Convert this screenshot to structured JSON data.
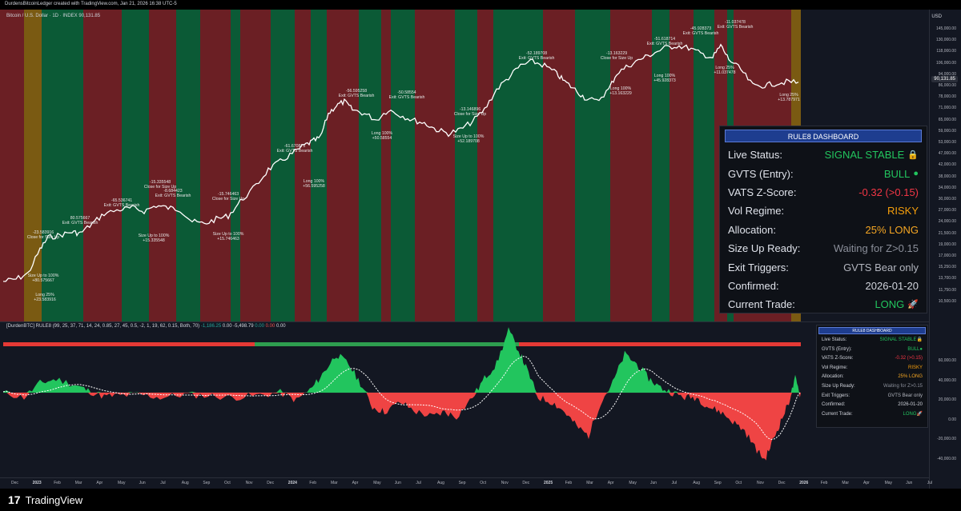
{
  "header": {
    "credit": "DurdensBitcoinLedger created with TradingView.com, Jan 21, 2026 16:38 UTC-5",
    "symbol": "Bitcoin / U.S. Dollar · 1D · INDEX",
    "last_price": "90,131.85",
    "currency": "USD",
    "current_price_label": "90,131.85"
  },
  "price_axis": [
    "145,000.00",
    "130,000.00",
    "118,000.00",
    "106,000.00",
    "94,000.00",
    "86,000.00",
    "78,000.00",
    "71,000.00",
    "65,000.00",
    "59,000.00",
    "53,000.00",
    "47,000.00",
    "42,000.00",
    "38,000.00",
    "34,000.00",
    "30,000.00",
    "27,000.00",
    "24,000.00",
    "21,500.00",
    "19,000.00",
    "17,000.00",
    "15,250.00",
    "13,700.00",
    "11,750.00",
    "10,500.00"
  ],
  "indicator_axis": [
    "60,000.00",
    "40,000.00",
    "20,000.00",
    "0.00",
    "-20,000.00",
    "-40,000.00"
  ],
  "time_axis": [
    "Dec",
    "2023",
    "Feb",
    "Mar",
    "Apr",
    "May",
    "Jun",
    "Jul",
    "Aug",
    "Sep",
    "Oct",
    "Nov",
    "Dec",
    "2024",
    "Feb",
    "Mar",
    "Apr",
    "May",
    "Jun",
    "Jul",
    "Aug",
    "Sep",
    "Oct",
    "Nov",
    "Dec",
    "2025",
    "Feb",
    "Mar",
    "Apr",
    "May",
    "Jun",
    "Jul",
    "Aug",
    "Sep",
    "Oct",
    "Nov",
    "Dec",
    "2026",
    "Feb",
    "Mar",
    "Apr",
    "May",
    "Jun",
    "Jul"
  ],
  "annotations": [
    {
      "text": "-23.583916"
    },
    {
      "text": "Close for Size Up"
    },
    {
      "text": "Size Up to 100%"
    },
    {
      "text": "+80.575667"
    },
    {
      "text": "Long 25%"
    },
    {
      "text": "+23.583916"
    },
    {
      "text": "80.575667"
    },
    {
      "text": "Exit: GVTS Bearish"
    },
    {
      "text": "-65.536741"
    },
    {
      "text": "Exit: GVTS Bearish"
    },
    {
      "text": "-15.335548"
    },
    {
      "text": "Close for Size Up"
    },
    {
      "text": "Size Up to 100%"
    },
    {
      "text": "+15.335548"
    },
    {
      "text": "-8.684423"
    },
    {
      "text": "Exit: GVTS Bearish"
    },
    {
      "text": "-15.746463"
    },
    {
      "text": "Close for Size Up"
    },
    {
      "text": "Size Up to 100%"
    },
    {
      "text": "+15.746463"
    },
    {
      "text": "-61.670875"
    },
    {
      "text": "Exit: GVTS Bearish"
    },
    {
      "text": "Long 100%"
    },
    {
      "text": "+56.595258"
    },
    {
      "text": "-56.595258"
    },
    {
      "text": "Exit: GVTS Bearish"
    },
    {
      "text": "-50.58554"
    },
    {
      "text": "Exit: GVTS Bearish"
    },
    {
      "text": "Long 100%"
    },
    {
      "text": "+50.58554"
    },
    {
      "text": "-13.146896"
    },
    {
      "text": "Close for Size Up"
    },
    {
      "text": "Size Up to 100%"
    },
    {
      "text": "+52.189708"
    },
    {
      "text": "-52.189708"
    },
    {
      "text": "Exit: GVTS Bearish"
    },
    {
      "text": "-13.163229"
    },
    {
      "text": "Close for Size Up"
    },
    {
      "text": "Long 100%"
    },
    {
      "text": "+13.163229"
    },
    {
      "text": "-51.618714"
    },
    {
      "text": "Exit: GVTS Bearish"
    },
    {
      "text": "Long 100%"
    },
    {
      "text": "+45.928373"
    },
    {
      "text": "-45.928373"
    },
    {
      "text": "Exit: GVTS Bearish"
    },
    {
      "text": "-11.037478"
    },
    {
      "text": "Exit: GVTS Bearish"
    },
    {
      "text": "Long 25%"
    },
    {
      "text": "+11.037478"
    },
    {
      "text": "Long 25%"
    },
    {
      "text": "+13.787971"
    }
  ],
  "indicator_label": "[DurdenBTC] RULE8 (99, 25, 37, 71, 14, 24, 0.85, 27, 45, 0.5, -2, 1, 19, 62, 0.15, Both, 70)",
  "indicator_values": [
    {
      "text": "-1,186.25",
      "color": "#26a69a"
    },
    {
      "text": "0.00",
      "color": "#d1d4dc"
    },
    {
      "text": "-5,498.79",
      "color": "#d1d4dc"
    },
    {
      "text": "0.00",
      "color": "#26a69a"
    },
    {
      "text": "0.00",
      "color": "#ef5350"
    },
    {
      "text": "0.00",
      "color": "#d1d4dc"
    }
  ],
  "dashboard": {
    "title": "RULE8 DASHBOARD",
    "rows": [
      {
        "key": "Live Status:",
        "value": "SIGNAL STABLE",
        "color": "#22c55e",
        "icon": "lock-icon",
        "glyph": "🔒"
      },
      {
        "key": "GVTS (Entry):",
        "value": "BULL",
        "color": "#22c55e",
        "icon": "green-circle-icon",
        "glyph": "●"
      },
      {
        "key": "VATS Z-Score:",
        "value": "-0.32 (>0.15)",
        "color": "#f23645",
        "icon": "",
        "glyph": ""
      },
      {
        "key": "Vol Regime:",
        "value": "RISKY",
        "color": "#f59e0b",
        "icon": "",
        "glyph": ""
      },
      {
        "key": "Allocation:",
        "value": "25% LONG",
        "color": "#f5a623",
        "icon": "",
        "glyph": ""
      },
      {
        "key": "Size Up Ready:",
        "value": "Waiting for Z>0.15",
        "color": "#8a8e99",
        "icon": "",
        "glyph": ""
      },
      {
        "key": "Exit Triggers:",
        "value": "GVTS Bear only",
        "color": "#b2b5be",
        "icon": "",
        "glyph": ""
      },
      {
        "key": "Confirmed:",
        "value": "2026-01-20",
        "color": "#d1d4dc",
        "icon": "",
        "glyph": ""
      },
      {
        "key": "Current Trade:",
        "value": "LONG",
        "color": "#22c55e",
        "icon": "rocket-icon",
        "glyph": "🚀"
      }
    ]
  },
  "footer": {
    "logo": "17",
    "brand": "TradingView"
  },
  "colors": {
    "bull_bg": "#0b5a36",
    "bear_bg": "#6b1f24",
    "neutral_bg": "#7a5a12",
    "price_line": "#ffffff",
    "pos_fill": "#22c55e",
    "neg_fill": "#ef4444"
  }
}
